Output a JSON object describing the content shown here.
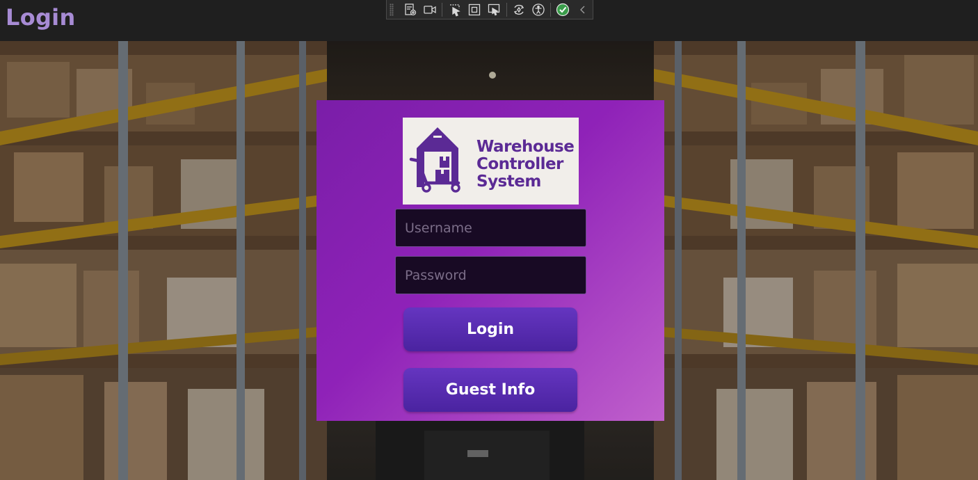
{
  "window": {
    "title": "Login"
  },
  "devtools_toolbar": {
    "icons": [
      "live-visual-tree-icon",
      "record-icon",
      "select-element-icon",
      "display-layout-adorners-icon",
      "track-focus-icon",
      "hot-reload-icon",
      "accessibility-icon",
      "binding-check-icon",
      "collapse-chevron-icon"
    ]
  },
  "login_card": {
    "logo": {
      "line1": "Warehouse",
      "line2": "Controller",
      "line3": "System"
    },
    "username": {
      "placeholder": "Username",
      "value": ""
    },
    "password": {
      "placeholder": "Password",
      "value": ""
    },
    "login_button": "Login",
    "guest_button": "Guest Info"
  },
  "colors": {
    "title": "#a78bd4",
    "card_gradient_start": "#7a1ea8",
    "card_gradient_end": "#c060cc",
    "button": "#5a2db5",
    "logo_purple": "#5b2a95"
  }
}
